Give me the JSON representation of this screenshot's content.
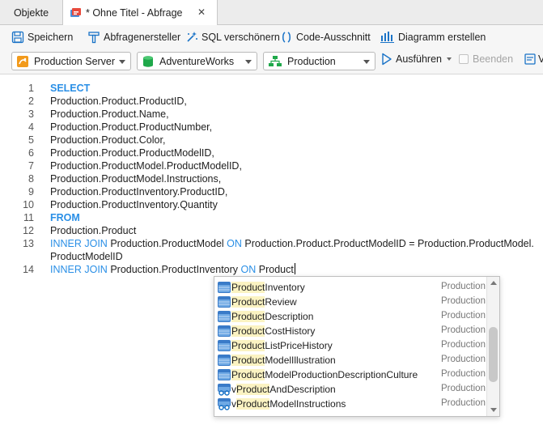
{
  "tabs": {
    "objects": "Objekte",
    "query": "* Ohne Titel - Abfrage"
  },
  "toolbar": {
    "save": "Speichern",
    "query_builder": "Abfragenersteller",
    "beautify": "SQL verschönern",
    "snippet": "Code-Ausschnitt",
    "chart": "Diagramm erstellen"
  },
  "connection": {
    "server": "Production Server",
    "database": "AdventureWorks",
    "schema": "Production",
    "run": "Ausführen",
    "stop": "Beenden",
    "more": "Ve"
  },
  "editor": {
    "lines": [
      {
        "num": "1",
        "kw": "SELECT",
        "text": ""
      },
      {
        "num": "2",
        "kw": "",
        "text": "Production.Product.ProductID,"
      },
      {
        "num": "3",
        "kw": "",
        "text": "Production.Product.Name,"
      },
      {
        "num": "4",
        "kw": "",
        "text": "Production.Product.ProductNumber,"
      },
      {
        "num": "5",
        "kw": "",
        "text": "Production.Product.Color,"
      },
      {
        "num": "6",
        "kw": "",
        "text": "Production.Product.ProductModelID,"
      },
      {
        "num": "7",
        "kw": "",
        "text": "Production.ProductModel.ProductModelID,"
      },
      {
        "num": "8",
        "kw": "",
        "text": "Production.ProductModel.Instructions,"
      },
      {
        "num": "9",
        "kw": "",
        "text": "Production.ProductInventory.ProductID,"
      },
      {
        "num": "10",
        "kw": "",
        "text": "Production.ProductInventory.Quantity"
      },
      {
        "num": "11",
        "kw": "FROM",
        "text": ""
      },
      {
        "num": "12",
        "kw": "",
        "text": "Production.Product"
      }
    ],
    "line13": {
      "num": "13",
      "kw1": "INNER JOIN",
      "t1": " Production.ProductModel ",
      "kw2": "ON",
      "t2": " Production.Product.ProductModelID = Production.ProductModel.",
      "wrap": "ProductModelID"
    },
    "line14": {
      "num": "14",
      "kw1": "INNER JOIN",
      "t1": " Production.ProductInventory ",
      "kw2": "ON",
      "t2": " Product"
    }
  },
  "autocomplete": {
    "typed": "Product",
    "items": [
      {
        "match": "Product",
        "rest": "Inventory",
        "schema": "Production",
        "icon": "table-icon"
      },
      {
        "match": "Product",
        "rest": "Review",
        "schema": "Production",
        "icon": "table-icon"
      },
      {
        "match": "Product",
        "rest": "Description",
        "schema": "Production",
        "icon": "table-icon"
      },
      {
        "match": "Product",
        "rest": "CostHistory",
        "schema": "Production",
        "icon": "table-icon"
      },
      {
        "match": "Product",
        "rest": "ListPriceHistory",
        "schema": "Production",
        "icon": "table-icon"
      },
      {
        "match": "Product",
        "rest": "ModelIllustration",
        "schema": "Production",
        "icon": "table-icon"
      },
      {
        "match": "Product",
        "rest": "ModelProductionDescriptionCulture",
        "schema": "Production",
        "icon": "table-icon"
      },
      {
        "prefix": "v",
        "match": "Product",
        "rest": "AndDescription",
        "schema": "Production",
        "icon": "view-icon"
      },
      {
        "prefix": "v",
        "match": "Product",
        "rest": "ModelInstructions",
        "schema": "Production",
        "icon": "view-icon"
      }
    ]
  },
  "colors": {
    "keyword": "#2a8fe6",
    "match_highlight": "#fbf3c2",
    "accent": "#1a73c7"
  }
}
